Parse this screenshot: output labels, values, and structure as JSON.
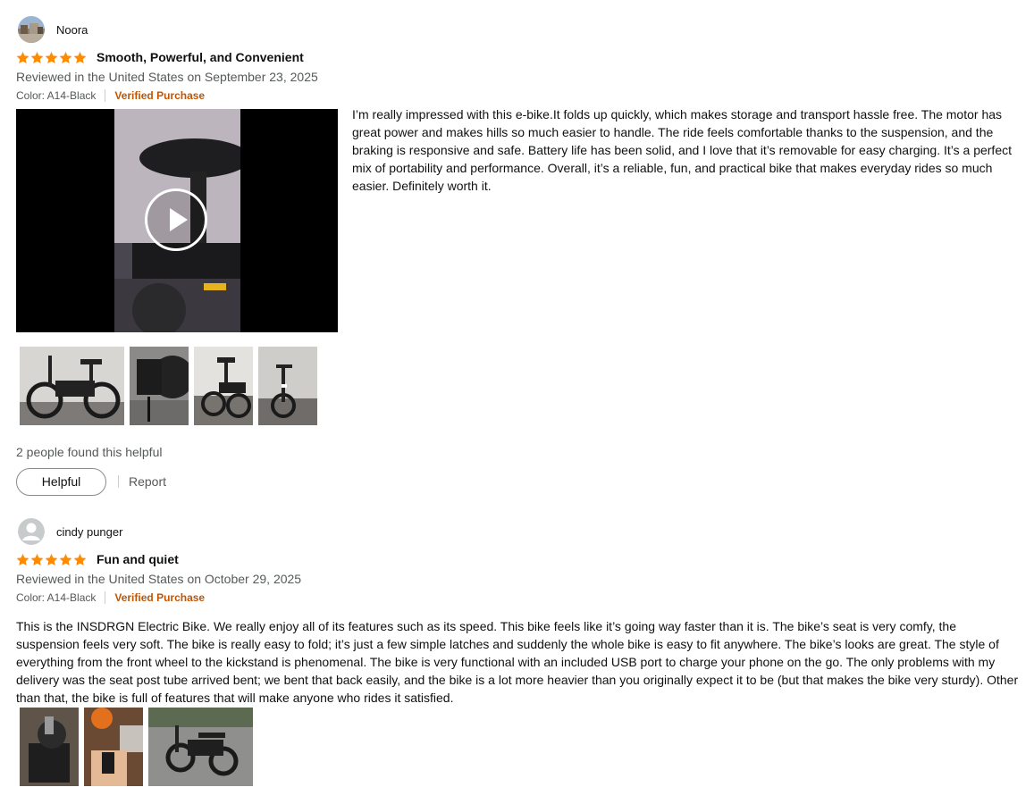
{
  "reviews": [
    {
      "reviewer": "Noora",
      "title": "Smooth, Powerful, and Convenient",
      "rating": 5,
      "date": "Reviewed in the United States on September 23, 2025",
      "color": "Color: A14-Black",
      "verified": "Verified Purchase",
      "body": "I’m really impressed with this e-bike.It folds up quickly, which makes storage and transport hassle free. The motor has great power and makes hills so much easier to handle. The ride feels comfortable thanks to the suspension, and the braking is responsive and safe. Battery life has been solid, and I love that it’s removable for easy charging. It’s a perfect mix of portability and performance. Overall, it’s a reliable, fun, and practical bike that makes everyday rides so much easier. Definitely worth it.",
      "helpful_count": "2 people found this helpful",
      "helpful_button": "Helpful",
      "report": "Report"
    },
    {
      "reviewer": "cindy punger",
      "title": "Fun and quiet",
      "rating": 5,
      "date": "Reviewed in the United States on October 29, 2025",
      "color": "Color: A14-Black",
      "verified": "Verified Purchase",
      "body": "This is the INSDRGN Electric Bike. We really enjoy all of its features such as its speed. This bike feels like it’s going way faster than it is. The bike’s seat is very comfy, the suspension feels very soft. The bike is really easy to fold; it’s just a few simple latches and suddenly the whole bike is easy to fit anywhere. The bike’s looks are great. The style of everything from the front wheel to the kickstand is phenomenal. The bike is very functional with an included USB port to charge your phone on the go. The only problems with my delivery was the seat post tube arrived bent; we bent that back easily, and the bike is a lot more heavier than you originally expect it to be (but that makes the bike very sturdy). Other than that, the bike is full of features that will make anyone who rides it satisfied."
    }
  ],
  "colors": {
    "star": "#ff8a00",
    "verified": "#c45500",
    "secondary_text": "#565959"
  },
  "icons": {
    "star": "star-icon",
    "play": "play-icon",
    "default_avatar": "default-avatar-icon"
  }
}
